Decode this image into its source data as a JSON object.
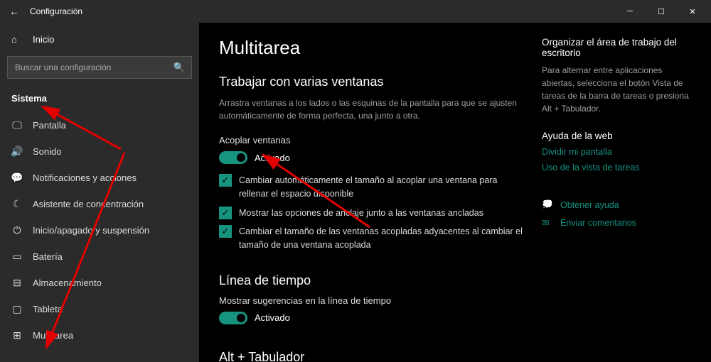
{
  "titlebar": {
    "back": "←",
    "title": "Configuración"
  },
  "sidebar": {
    "home": "Inicio",
    "search_placeholder": "Buscar una configuración",
    "category": "Sistema",
    "items": [
      {
        "label": "Pantalla"
      },
      {
        "label": "Sonido"
      },
      {
        "label": "Notificaciones y acciones"
      },
      {
        "label": "Asistente de concentración"
      },
      {
        "label": "Inicio/apagado y suspensión"
      },
      {
        "label": "Batería"
      },
      {
        "label": "Almacenamiento"
      },
      {
        "label": "Tableta"
      },
      {
        "label": "Multitarea"
      }
    ]
  },
  "page": {
    "title": "Multitarea",
    "snap": {
      "heading": "Trabajar con varias ventanas",
      "desc": "Arrastra ventanas a los lados o las esquinas de la pantalla para que se ajusten automáticamente de forma perfecta, una junto a otra.",
      "toggle_label": "Acoplar ventanas",
      "toggle_state": "Activado",
      "checks": [
        "Cambiar automáticamente el tamaño al acoplar una ventana para rellenar el espacio disponible",
        "Mostrar las opciones de anclaje junto a las ventanas ancladas",
        "Cambiar el tamaño de las ventanas acopladas adyacentes al cambiar el tamaño de una ventana acoplada"
      ]
    },
    "timeline": {
      "heading": "Línea de tiempo",
      "toggle_label": "Mostrar sugerencias en la línea de tiempo",
      "toggle_state": "Activado"
    },
    "alttab": {
      "heading": "Alt + Tabulador"
    }
  },
  "side": {
    "organize_h": "Organizar el área de trabajo del escritorio",
    "organize_p": "Para alternar entre aplicaciones abiertas, selecciona el botón Vista de tareas de la barra de tareas o presiona Alt + Tabulador.",
    "webhelp_h": "Ayuda de la web",
    "links": [
      "Dividir mi pantalla",
      "Uso de la vista de tareas"
    ],
    "get_help": "Obtener ayuda",
    "feedback": "Enviar comentarios"
  }
}
